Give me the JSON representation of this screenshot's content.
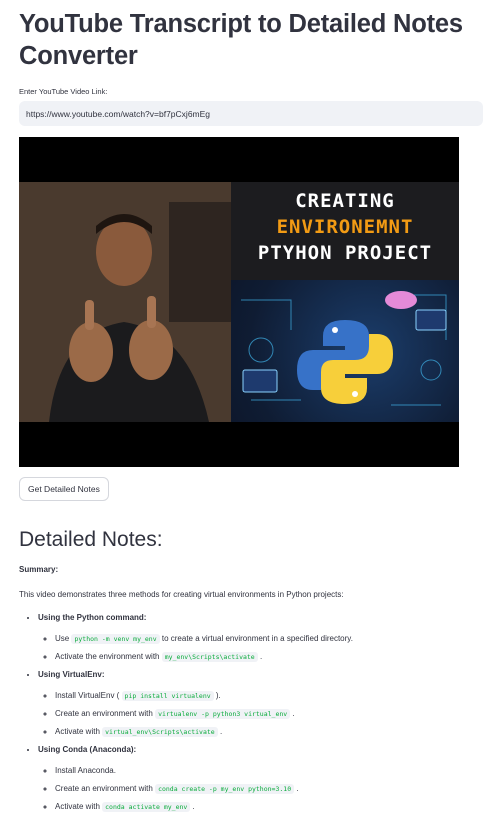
{
  "app": {
    "title": "YouTube Transcript to Detailed Notes Converter"
  },
  "input": {
    "label": "Enter YouTube Video Link:",
    "value": "https://www.youtube.com/watch?v=bf7pCxj6mEg"
  },
  "video": {
    "line1": "CREATING",
    "line2": "ENVIRONEMNT",
    "line3": "PTYHON  PROJECT"
  },
  "button": {
    "label": "Get Detailed Notes"
  },
  "notes": {
    "heading": "Detailed Notes:",
    "summary_label": "Summary:",
    "summary_text": "This video demonstrates three methods for creating virtual environments in Python projects:",
    "methods": [
      {
        "title": "Using the Python command:",
        "items": [
          {
            "pre": "Use ",
            "code": "python -m venv my_env",
            "post": " to create a virtual environment in a specified directory."
          },
          {
            "pre": "Activate the environment with ",
            "code": "my_env\\Scripts\\activate",
            "post": " ."
          }
        ]
      },
      {
        "title": "Using VirtualEnv:",
        "items": [
          {
            "pre": "Install VirtualEnv ( ",
            "code": "pip install virtualenv",
            "post": " )."
          },
          {
            "pre": "Create an environment with ",
            "code": "virtualenv -p python3 virtual_env",
            "post": " ."
          },
          {
            "pre": "Activate with ",
            "code": "virtual_env\\Scripts\\activate",
            "post": " ."
          }
        ]
      },
      {
        "title": "Using Conda (Anaconda):",
        "items": [
          {
            "pre": "Install Anaconda.",
            "code": "",
            "post": ""
          },
          {
            "pre": "Create an environment with ",
            "code": "conda create -p my_env python=3.10",
            "post": " ."
          },
          {
            "pre": "Activate with ",
            "code": "conda activate my_env",
            "post": " ."
          }
        ]
      }
    ]
  },
  "colors": {
    "code_text": "#09ab3b",
    "input_bg": "#f0f2f6",
    "text": "#31333f",
    "accent_orange": "#f29b14"
  }
}
